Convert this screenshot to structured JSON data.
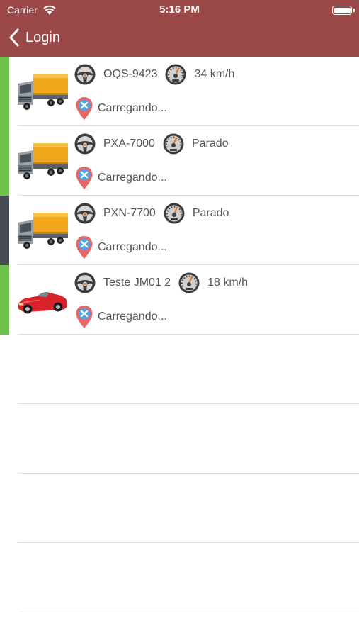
{
  "status_bar": {
    "carrier": "Carrier",
    "time": "5:16 PM"
  },
  "nav": {
    "back_label": "Login"
  },
  "colors": {
    "header": "#9b4848",
    "moving": "#6cc24a",
    "stopped": "#454a52"
  },
  "vehicles": [
    {
      "plate": "OQS-9423",
      "speed": "34 km/h",
      "address": "Carregando...",
      "status_color": "#6cc24a",
      "type": "truck"
    },
    {
      "plate": "PXA-7000",
      "speed": "Parado",
      "address": "Carregando...",
      "status_color": "#6cc24a",
      "type": "truck"
    },
    {
      "plate": "PXN-7700",
      "speed": "Parado",
      "address": "Carregando...",
      "status_color": "#454a52",
      "type": "truck"
    },
    {
      "plate": "Teste JM01 2",
      "speed": "18 km/h",
      "address": "Carregando...",
      "status_color": "#6cc24a",
      "type": "car"
    }
  ]
}
